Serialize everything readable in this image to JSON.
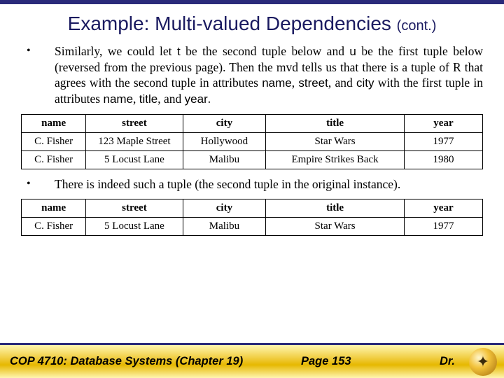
{
  "title_main": "Example: Multi-valued Dependencies",
  "title_cont": "(cont.)",
  "bullets": {
    "b1_p1": "Similarly, we could let ",
    "b1_t": "t",
    "b1_p2": " be the second tuple below and ",
    "b1_u": "u",
    "b1_p3": " be the first tuple below (reversed from the previous page). Then the mvd tells us that there is a tuple of R that agrees with the second tuple in attributes ",
    "b1_name": "name",
    "b1_c1": ", ",
    "b1_street": "street",
    "b1_c2": ", and ",
    "b1_city": "city",
    "b1_p4": " with the first tuple in attributes ",
    "b1_name2": "name",
    "b1_c3": ", ",
    "b1_title": "title",
    "b1_c4": ", and ",
    "b1_year": "year",
    "b1_end": ".",
    "b2": "There is indeed such a tuple (the second tuple in the original instance)."
  },
  "headers": {
    "name": "name",
    "street": "street",
    "city": "city",
    "title": "title",
    "year": "year"
  },
  "table1": [
    {
      "name": "C. Fisher",
      "street": "123 Maple Street",
      "city": "Hollywood",
      "title": "Star Wars",
      "year": "1977"
    },
    {
      "name": "C. Fisher",
      "street": "5 Locust Lane",
      "city": "Malibu",
      "title": "Empire Strikes Back",
      "year": "1980"
    }
  ],
  "table2": [
    {
      "name": "C. Fisher",
      "street": "5 Locust Lane",
      "city": "Malibu",
      "title": "Star Wars",
      "year": "1977"
    }
  ],
  "footer": {
    "course": "COP 4710: Database Systems  (Chapter 19)",
    "page": "Page 153",
    "author": "Dr."
  }
}
